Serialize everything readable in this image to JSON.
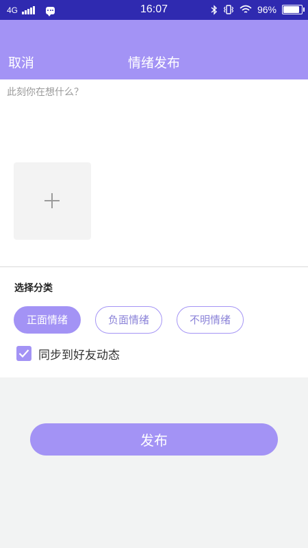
{
  "status_bar": {
    "network": "4G",
    "time": "16:07",
    "battery": "96%",
    "battery_level": 0.96
  },
  "header": {
    "cancel_label": "取消",
    "title": "情绪发布"
  },
  "compose": {
    "placeholder": "此刻你在想什么？",
    "value": ""
  },
  "category": {
    "title": "选择分类",
    "options": [
      {
        "label": "正面情绪",
        "selected": true
      },
      {
        "label": "负面情绪",
        "selected": false
      },
      {
        "label": "不明情绪",
        "selected": false
      }
    ]
  },
  "sync": {
    "label": "同步到好友动态",
    "checked": true
  },
  "publish_label": "发布",
  "colors": {
    "status_bar": "#2f2ab0",
    "accent": "#a393f5",
    "background": "#f2f3f3"
  }
}
